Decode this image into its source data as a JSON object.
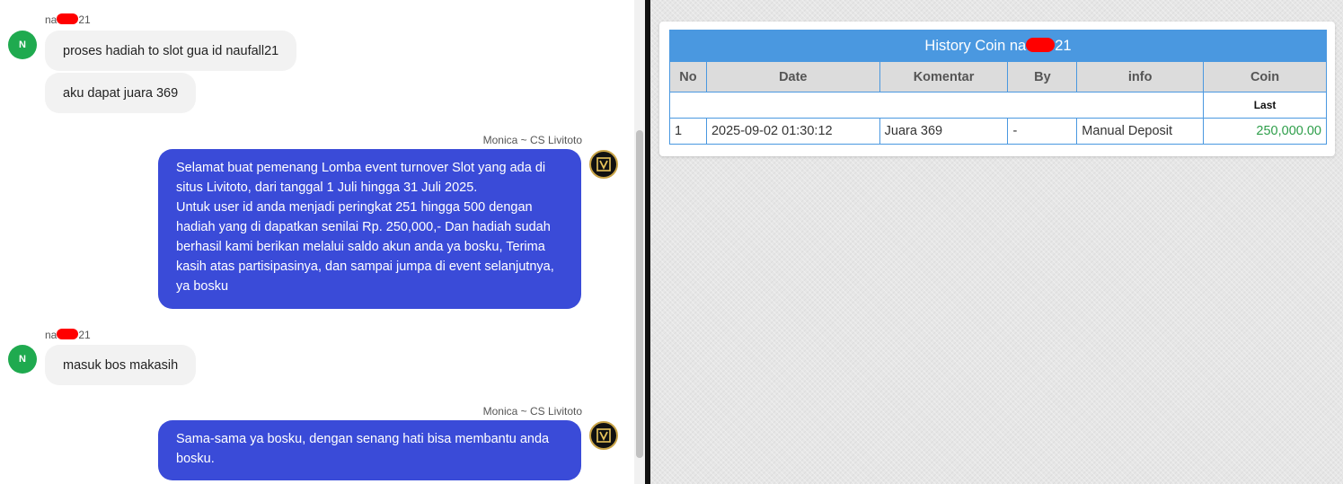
{
  "chat": {
    "messages": [
      {
        "id": "u1",
        "sender_prefix": "na",
        "sender_suffix": "21",
        "avatar_letter": "N",
        "bubbles": [
          "proses hadiah to slot gua id naufall21",
          "aku dapat juara 369"
        ]
      },
      {
        "id": "a1",
        "agent_name": "Monica ~ CS Livitoto",
        "lines": [
          "Selamat buat pemenang Lomba event turnover Slot yang ada di",
          "situs Livitoto, dari tanggal 1 Juli hingga 31 Juli 2025.",
          "Untuk user id anda menjadi peringkat 251 hingga 500 dengan",
          "hadiah yang di dapatkan senilai Rp. 250,000,- Dan hadiah sudah",
          "berhasil kami berikan melalui saldo akun anda ya bosku, Terima",
          "kasih atas partisipasinya, dan sampai jumpa di event selanjutnya,",
          "ya bosku"
        ]
      },
      {
        "id": "u2",
        "sender_prefix": "na",
        "sender_suffix": "21",
        "avatar_letter": "N",
        "bubbles": [
          "masuk bos makasih"
        ]
      },
      {
        "id": "a2",
        "agent_name": "Monica ~ CS Livitoto",
        "lines": [
          "Sama-sama ya bosku, dengan senang hati bisa membantu anda",
          "bosku."
        ]
      }
    ]
  },
  "history": {
    "title_prefix": "History Coin na",
    "title_suffix": "21",
    "headers": [
      "No",
      "Date",
      "Komentar",
      "By",
      "info",
      "Coin"
    ],
    "last_label": "Last",
    "rows": [
      {
        "no": "1",
        "date": "2025-09-02 01:30:12",
        "komentar": "Juara 369",
        "by": "-",
        "info": "Manual Deposit",
        "coin": "250,000.00"
      }
    ]
  },
  "colors": {
    "user_avatar": "#1faa4f",
    "agent_bubble": "#3a4bd8",
    "incoming_bubble": "#f2f2f2",
    "table_header": "#4a98e0",
    "coin_positive": "#2e9e4a",
    "redaction": "#ff0000"
  },
  "icons": {
    "agent_avatar": "livitoto-logo-icon"
  }
}
